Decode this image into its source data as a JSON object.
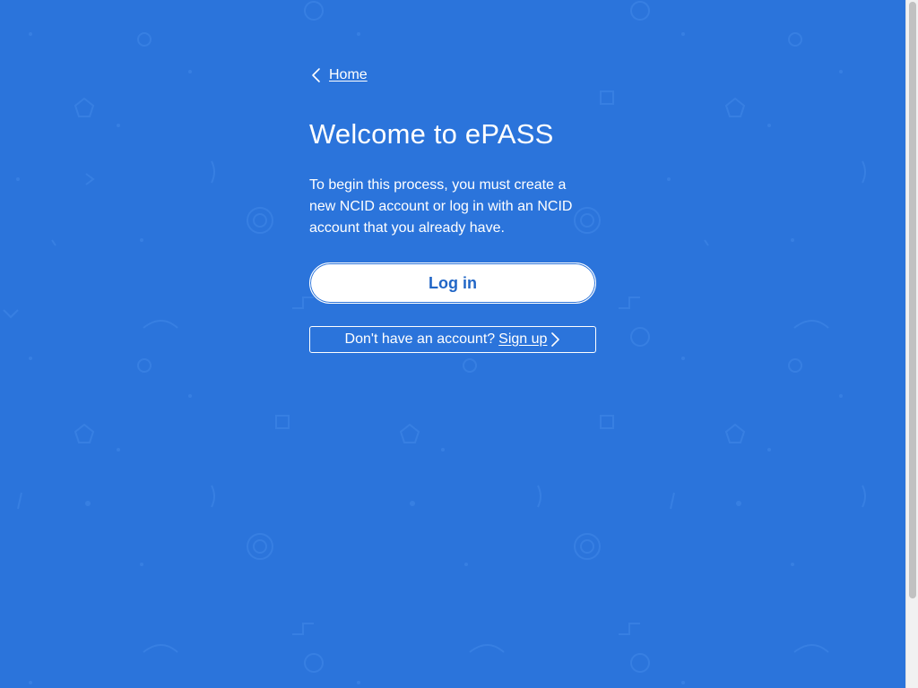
{
  "nav": {
    "back_label": "Home",
    "back_icon": "chevron-left-icon"
  },
  "main": {
    "title": "Welcome to ePASS",
    "intro": "To begin this process, you must create a new NCID account or log in with an NCID account that you already have.",
    "login_label": "Log in",
    "signup_prompt": "Don't have an account?",
    "signup_label": "Sign up",
    "signup_icon": "chevron-right-icon"
  },
  "colors": {
    "background": "#2b74db",
    "text": "#ffffff",
    "button_text": "#2166c6"
  }
}
